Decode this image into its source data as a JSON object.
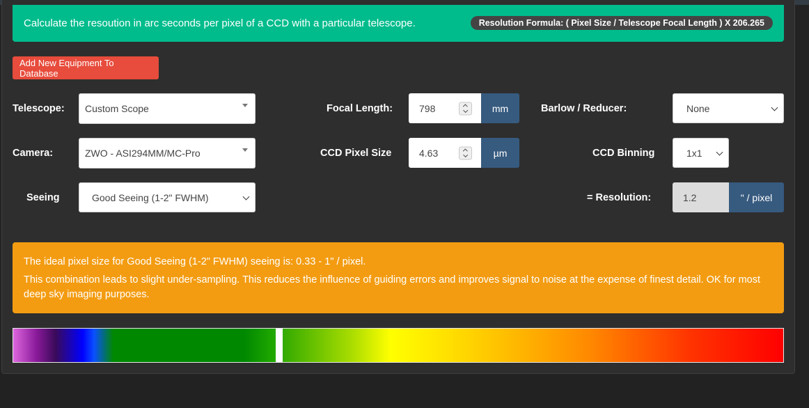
{
  "banner": {
    "description": "Calculate the resoution in arc seconds per pixel of a CCD with a particular telescope.",
    "formula": "Resolution Formula:  (  Pixel Size  /  Telescope Focal Length  )  X 206.265"
  },
  "buttons": {
    "add_equipment": "Add New Equipment To Database"
  },
  "form": {
    "telescope": {
      "label": "Telescope:",
      "value": "Custom Scope"
    },
    "camera": {
      "label": "Camera:",
      "value": "ZWO - ASI294MM/MC-Pro"
    },
    "seeing": {
      "label": "Seeing",
      "value": "Good Seeing (1-2\" FWHM)"
    },
    "focal_length": {
      "label": "Focal Length:",
      "value": "798",
      "unit": "mm"
    },
    "pixel_size": {
      "label": "CCD Pixel Size",
      "value": "4.63",
      "unit": "µm"
    },
    "barlow": {
      "label": "Barlow / Reducer:",
      "value": "None"
    },
    "binning": {
      "label": "CCD Binning",
      "value": "1x1"
    },
    "resolution": {
      "label": "=  Resolution:",
      "value": "1.2",
      "unit": "\" / pixel"
    }
  },
  "advice": {
    "line1": "The ideal pixel size for Good Seeing (1-2\" FWHM) seeing is: 0.33 - 1\" / pixel.",
    "line2": "This combination leads to slight under-sampling. This reduces the influence of guiding errors and improves signal to noise at the expense of finest detail. OK for most deep sky imaging purposes."
  },
  "spectrum": {
    "marker_fraction": 0.345
  },
  "colors": {
    "success": "#00bc8c",
    "danger": "#e74c3c",
    "warning": "#f39c12",
    "primary": "#375a7f",
    "background": "#222222"
  }
}
